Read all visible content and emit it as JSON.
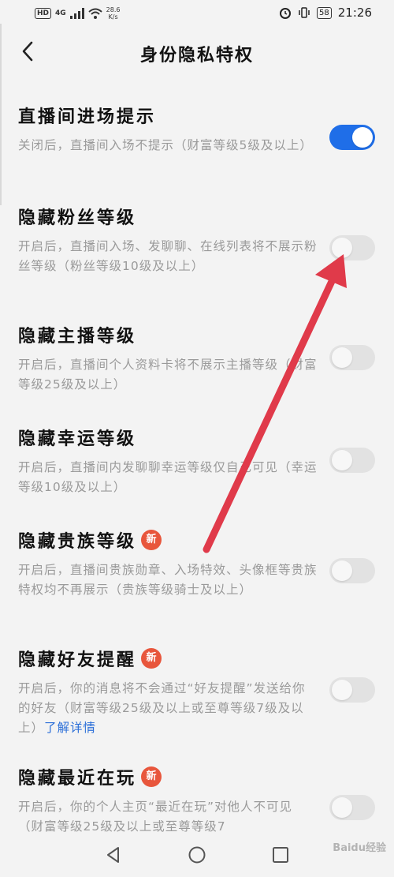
{
  "status_bar": {
    "hd": "HD",
    "network": "4G",
    "speed": "28.6",
    "speed_unit": "K/s",
    "battery": "58",
    "time": "21:26"
  },
  "header": {
    "title": "身份隐私特权"
  },
  "items": [
    {
      "title": "直播间进场提示",
      "desc": "关闭后，直播间入场不提示（财富等级5级及以上）",
      "on": true,
      "badge": ""
    },
    {
      "title": "隐藏粉丝等级",
      "desc": "开启后，直播间入场、发聊聊、在线列表将不展示粉丝等级（粉丝等级10级及以上）",
      "on": false,
      "badge": ""
    },
    {
      "title": "隐藏主播等级",
      "desc": "开启后，直播间个人资料卡将不展示主播等级（财富等级25级及以上）",
      "on": false,
      "badge": ""
    },
    {
      "title": "隐藏幸运等级",
      "desc": "开启后，直播间内发聊聊幸运等级仅自己可见（幸运等级10级及以上）",
      "on": false,
      "badge": ""
    },
    {
      "title": "隐藏贵族等级",
      "desc": "开启后，直播间贵族勋章、入场特效、头像框等贵族特权均不再展示（贵族等级骑士及以上）",
      "on": false,
      "badge": "新"
    },
    {
      "title": "隐藏好友提醒",
      "desc": "开启后，你的消息将不会通过“好友提醒”发送给你的好友（财富等级25级及以上或至尊等级7级及以上）",
      "link": "了解详情",
      "on": false,
      "badge": "新"
    },
    {
      "title": "隐藏最近在玩",
      "desc": "开启后，你的个人主页“最近在玩”对他人不可见（财富等级25级及以上或至尊等级7",
      "on": false,
      "badge": "新"
    }
  ],
  "watermark": "Baidu经验",
  "colors": {
    "accent": "#1f6ee8",
    "badge": "#e8563c",
    "arrow": "#e03a4a"
  }
}
